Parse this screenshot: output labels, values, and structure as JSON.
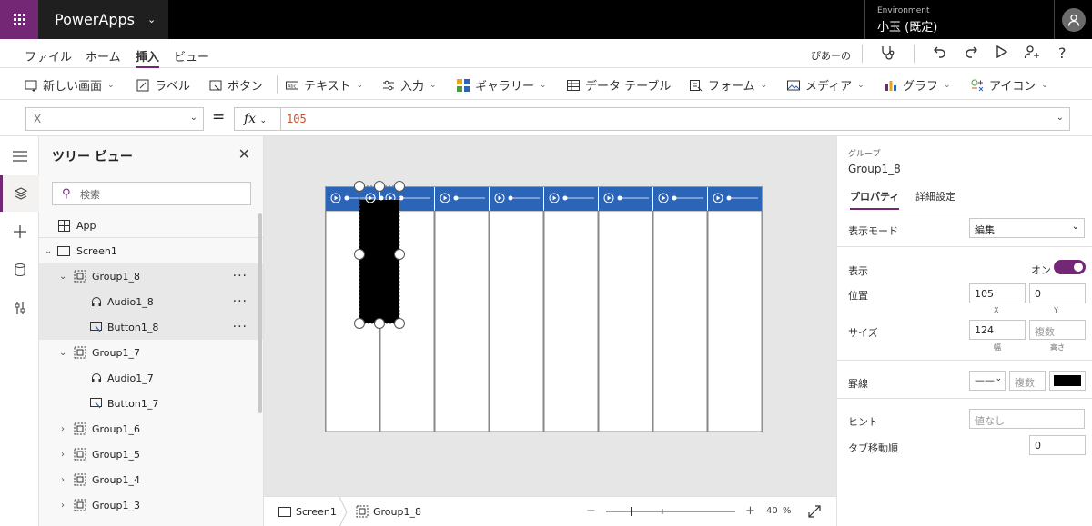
{
  "topbar": {
    "app_name": "PowerApps",
    "env_label": "Environment",
    "env_name": "小玉 (既定)"
  },
  "menu": {
    "items": [
      "ファイル",
      "ホーム",
      "挿入",
      "ビュー"
    ],
    "active": "挿入",
    "user_name": "ぴあーの"
  },
  "ribbon": {
    "items": [
      "新しい画面",
      "ラベル",
      "ボタン",
      "テキスト",
      "入力",
      "ギャラリー",
      "データ テーブル",
      "フォーム",
      "メディア",
      "グラフ",
      "アイコン"
    ]
  },
  "formula": {
    "property": "X",
    "equals": "=",
    "fx": "fx",
    "value": "105"
  },
  "tree": {
    "title": "ツリー ビュー",
    "search_placeholder": "検索",
    "items": [
      {
        "label": "App"
      },
      {
        "label": "Screen1"
      },
      {
        "label": "Group1_8"
      },
      {
        "label": "Audio1_8"
      },
      {
        "label": "Button1_8"
      },
      {
        "label": "Group1_7"
      },
      {
        "label": "Audio1_7"
      },
      {
        "label": "Button1_7"
      },
      {
        "label": "Group1_6"
      },
      {
        "label": "Group1_5"
      },
      {
        "label": "Group1_4"
      },
      {
        "label": "Group1_3"
      }
    ],
    "more": "···"
  },
  "bottom": {
    "screen": "Screen1",
    "group": "Group1_8",
    "zoom": "40",
    "zoom_unit": "%",
    "minus": "−",
    "plus": "+"
  },
  "props": {
    "type_label": "グループ",
    "name": "Group1_8",
    "tab_props": "プロパティ",
    "tab_adv": "詳細設定",
    "display_mode_label": "表示モード",
    "display_mode_value": "編集",
    "visible_label": "表示",
    "visible_value": "オン",
    "position_label": "位置",
    "x": "105",
    "y": "0",
    "x_label": "X",
    "y_label": "Y",
    "size_label": "サイズ",
    "width": "124",
    "height_placeholder": "複数",
    "width_label": "幅",
    "height_label": "高さ",
    "border_label": "罫線",
    "border_style": "——",
    "border_width_placeholder": "複数",
    "hint_label": "ヒント",
    "hint_placeholder": "値なし",
    "tab_index_label": "タブ移動順",
    "tab_index": "0"
  },
  "colors": {
    "accent": "#742774",
    "header_blue": "#2b65b7",
    "topbar": "#000000"
  }
}
